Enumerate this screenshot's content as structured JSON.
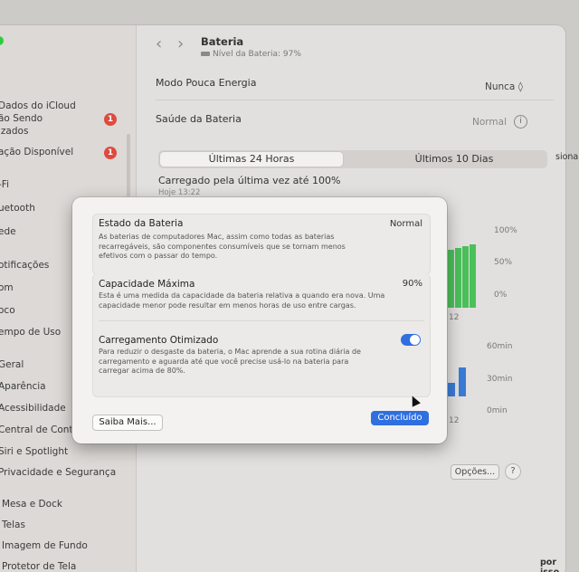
{
  "sidebar": {
    "items": [
      {
        "label": "Dados do iCloud"
      },
      {
        "label": "ão Sendo"
      },
      {
        "label": "izados"
      },
      {
        "label": "ação Disponível"
      },
      {
        "label": "-Fi"
      },
      {
        "label": "uetooth"
      },
      {
        "label": "ede"
      },
      {
        "label": "otificações"
      },
      {
        "label": "om"
      },
      {
        "label": "oco"
      },
      {
        "label": "empo de Uso"
      },
      {
        "label": "Geral"
      },
      {
        "label": "Aparência"
      },
      {
        "label": "Acessibilidade"
      },
      {
        "label": "Central de Contro"
      },
      {
        "label": "Siri e Spotlight"
      },
      {
        "label": "Privacidade e Segurança"
      },
      {
        "label": "Mesa e Dock"
      },
      {
        "label": "Telas"
      },
      {
        "label": "Imagem de Fundo"
      },
      {
        "label": "Protetor de Tela"
      }
    ],
    "badges": [
      "1",
      "1"
    ]
  },
  "header": {
    "title": "Bateria",
    "subtitle": "Nível da Bateria: 97%"
  },
  "settings": {
    "low_power_label": "Modo Pouca Energia",
    "low_power_value": "Nunca ◊",
    "health_label": "Saúde da Bateria",
    "health_value": "Normal",
    "info_glyph": "i"
  },
  "tabs": [
    {
      "label": "Últimas 24 Horas",
      "active": true
    },
    {
      "label": "Últimos 10 Dias",
      "active": false
    }
  ],
  "charged": {
    "text": "Carregado pela última vez até 100%",
    "time": "Hoje 13:22"
  },
  "chart_labels": {
    "level_ticks": [
      "100%",
      "50%",
      "0%"
    ],
    "usage_ticks": [
      "60min",
      "30min",
      "0min"
    ],
    "x_tick": "12"
  },
  "footer": {
    "options_label": "Opções...",
    "help_label": "?",
    "right_edge_top": "siona",
    "right_edge_bottom": "por isso."
  },
  "dialog": {
    "status": {
      "title": "Estado da Bateria",
      "value": "Normal",
      "desc": "As baterias de computadores Mac, assim como todas as baterias recarregáveis, são componentes consumíveis que se tornam menos efetivos com o passar do tempo."
    },
    "capacity": {
      "title": "Capacidade Máxima",
      "value": "90%",
      "desc": "Esta é uma medida da capacidade da bateria relativa a quando era nova. Uma capacidade menor pode resultar em menos horas de uso entre cargas."
    },
    "optimized": {
      "title": "Carregamento Otimizado",
      "enabled": true,
      "desc": "Para reduzir o desgaste da bateria, o Mac aprende a sua rotina diária de carregamento e aguarda até que você precise usá-lo na bateria para carregar acima de 80%."
    },
    "learn_more_label": "Saiba Mais...",
    "done_label": "Concluído"
  },
  "colors": {
    "accent": "#2f6fe0",
    "badge": "#e04a3f",
    "chart_green": "#4bbf5a",
    "chart_blue": "#3a7bd5"
  }
}
